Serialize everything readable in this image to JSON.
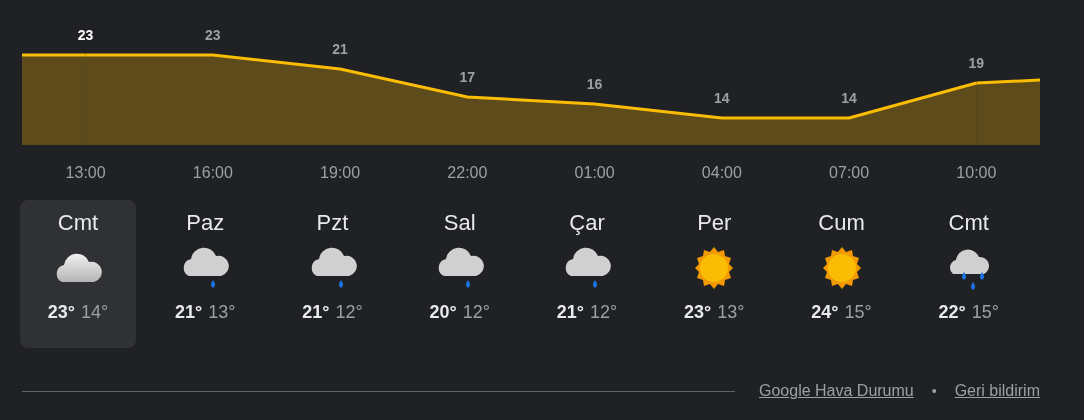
{
  "chart_data": {
    "type": "area",
    "categories": [
      "13:00",
      "16:00",
      "19:00",
      "22:00",
      "01:00",
      "04:00",
      "07:00",
      "10:00"
    ],
    "series": [
      {
        "color": "#fbbc04",
        "values": [
          23,
          23,
          21,
          17,
          16,
          14,
          14,
          19
        ]
      }
    ],
    "data_labels": true
  },
  "days": [
    {
      "name": "Cmt",
      "kind": "cloudy",
      "high": "23°",
      "low": "14°",
      "selected": true
    },
    {
      "name": "Paz",
      "kind": "rain",
      "high": "21°",
      "low": "13°",
      "selected": false
    },
    {
      "name": "Pzt",
      "kind": "rain",
      "high": "21°",
      "low": "12°",
      "selected": false
    },
    {
      "name": "Sal",
      "kind": "rain",
      "high": "20°",
      "low": "12°",
      "selected": false
    },
    {
      "name": "Çar",
      "kind": "rain",
      "high": "21°",
      "low": "12°",
      "selected": false
    },
    {
      "name": "Per",
      "kind": "sunny",
      "high": "23°",
      "low": "13°",
      "selected": false
    },
    {
      "name": "Cum",
      "kind": "sunny",
      "high": "24°",
      "low": "15°",
      "selected": false
    },
    {
      "name": "Cmt",
      "kind": "showers",
      "high": "22°",
      "low": "15°",
      "selected": false
    }
  ],
  "footer": {
    "source": "Google Hava Durumu",
    "separator": "•",
    "feedback": "Geri bildirim"
  }
}
